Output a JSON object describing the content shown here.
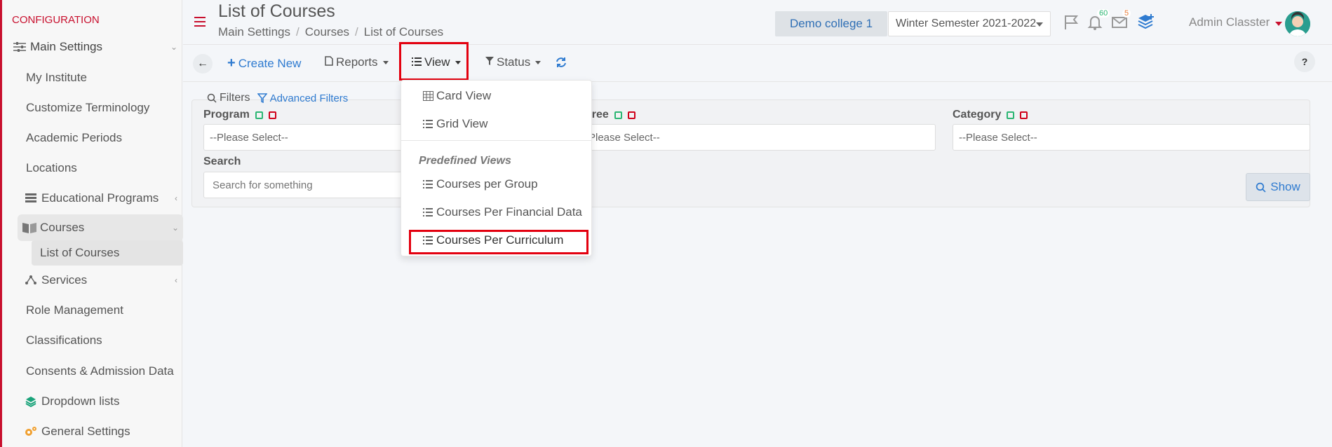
{
  "sidebar": {
    "header": "CONFIGURATION",
    "items": [
      {
        "label": "Main Settings",
        "icon": "sliders-icon"
      },
      {
        "label": "My Institute"
      },
      {
        "label": "Customize Terminology"
      },
      {
        "label": "Academic Periods"
      },
      {
        "label": "Locations"
      },
      {
        "label": "Educational Programs",
        "icon": "server-icon"
      },
      {
        "label": "Courses",
        "icon": "book-icon"
      },
      {
        "label": "List of Courses"
      },
      {
        "label": "Services",
        "icon": "share-nodes-icon"
      },
      {
        "label": "Role Management"
      },
      {
        "label": "Classifications"
      },
      {
        "label": "Consents & Admission Data"
      },
      {
        "label": "Dropdown lists",
        "icon": "layers-icon"
      },
      {
        "label": "General Settings",
        "icon": "gears-icon"
      }
    ]
  },
  "header": {
    "title": "List of Courses",
    "breadcrumb": [
      "Main Settings",
      "Courses",
      "List of Courses"
    ],
    "college": "Demo college 1",
    "semester": "Winter Semester 2021-2022",
    "notifications_count": "60",
    "messages_count": "5",
    "user": "Admin Classter"
  },
  "toolbar": {
    "create_new": "Create New",
    "reports": "Reports",
    "view": "View",
    "status": "Status",
    "help": "?"
  },
  "filters": {
    "title": "Filters",
    "advanced": "Advanced Filters",
    "program_label": "Program",
    "degree_label": "gree",
    "category_label": "Category",
    "program_value": "--Please Select--",
    "degree_value": "Please Select--",
    "category_value": "--Please Select--",
    "search_label": "Search",
    "search_placeholder": "Search for something",
    "show_button": "Show"
  },
  "view_menu": {
    "card_view": "Card View",
    "grid_view": "Grid View",
    "predefined_header": "Predefined Views",
    "per_group": "Courses per Group",
    "per_financial": "Courses Per Financial Data",
    "per_curriculum": "Courses Per Curriculum"
  },
  "colors": {
    "accent_red": "#c8102e",
    "link_blue": "#2f7bd0",
    "highlight_red": "#e3000f"
  }
}
